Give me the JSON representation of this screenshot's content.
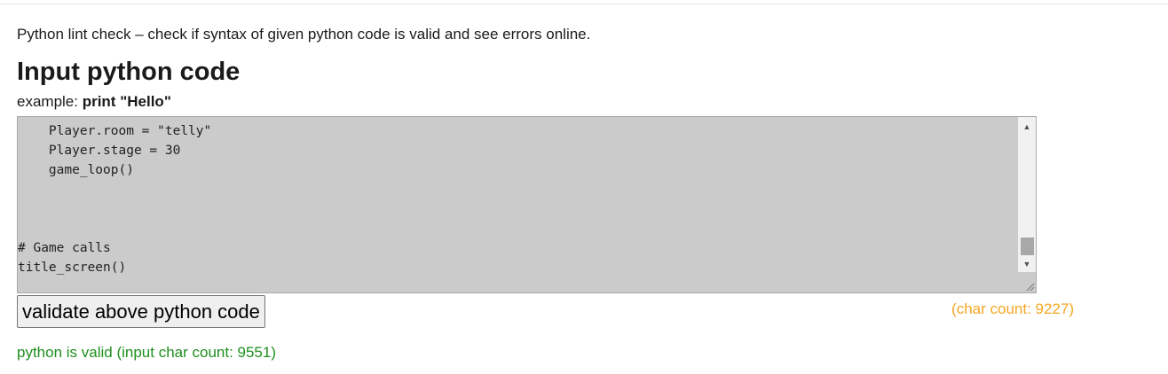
{
  "intro": "Python lint check – check if syntax of given python code is valid and see errors online.",
  "heading": "Input python code",
  "example": {
    "label": "example: ",
    "code": "print \"Hello\""
  },
  "editor": {
    "lines": [
      "    Player.room = \"telly\"",
      "    Player.stage = 30",
      "    game_loop()",
      "",
      "",
      "",
      "# Game calls",
      "title_screen()"
    ],
    "background": "#cbcbcb"
  },
  "validate_button": "validate above python code",
  "char_count": "(char count: 9227)",
  "result": "python is valid (input char count: 9551)",
  "colors": {
    "char_count": "#f5a623",
    "result": "#1f8f1f"
  }
}
